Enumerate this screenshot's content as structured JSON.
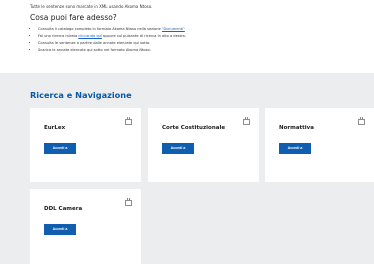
{
  "intro": {
    "text": "Tutte le sentenze sono marcate in XML usando Akoma Ntoso.",
    "subtitle": "Cosa puoi fare adesso?",
    "bullets": [
      {
        "before": "Consulta il catalogo completo in formato Akoma Ntoso nella sezione ",
        "link": "\"Documenti\"",
        "after": ""
      },
      {
        "before": "Fai una ricerca mirata ",
        "link": "cliccando qui",
        "after": " oppure sul pulsante di ricerca in alto a destra."
      },
      {
        "before": "Consulta le sentenze a partire dalle annate elencate qui sotto.",
        "link": "",
        "after": ""
      },
      {
        "before": "Scarica le annate elencate qui sotto nel formato Akoma Ntoso.",
        "link": "",
        "after": ""
      }
    ]
  },
  "section": {
    "title": "Ricerca e Navigazione",
    "cards": [
      {
        "title": "EurLex",
        "button": "Accedi a",
        "icon": "calendar-icon"
      },
      {
        "title": "Corte Costituzionale",
        "button": "Accedi a",
        "icon": "calendar-icon"
      },
      {
        "title": "Normattiva",
        "button": "Accedi a",
        "icon": "calendar-icon"
      },
      {
        "title": "DDL Camera",
        "button": "Accedi a",
        "icon": "calendar-icon"
      }
    ]
  },
  "colors": {
    "accent": "#0f5eb0",
    "heading": "#0a5aa8",
    "panel_bg": "#ebedee",
    "link": "#1a63c8"
  }
}
